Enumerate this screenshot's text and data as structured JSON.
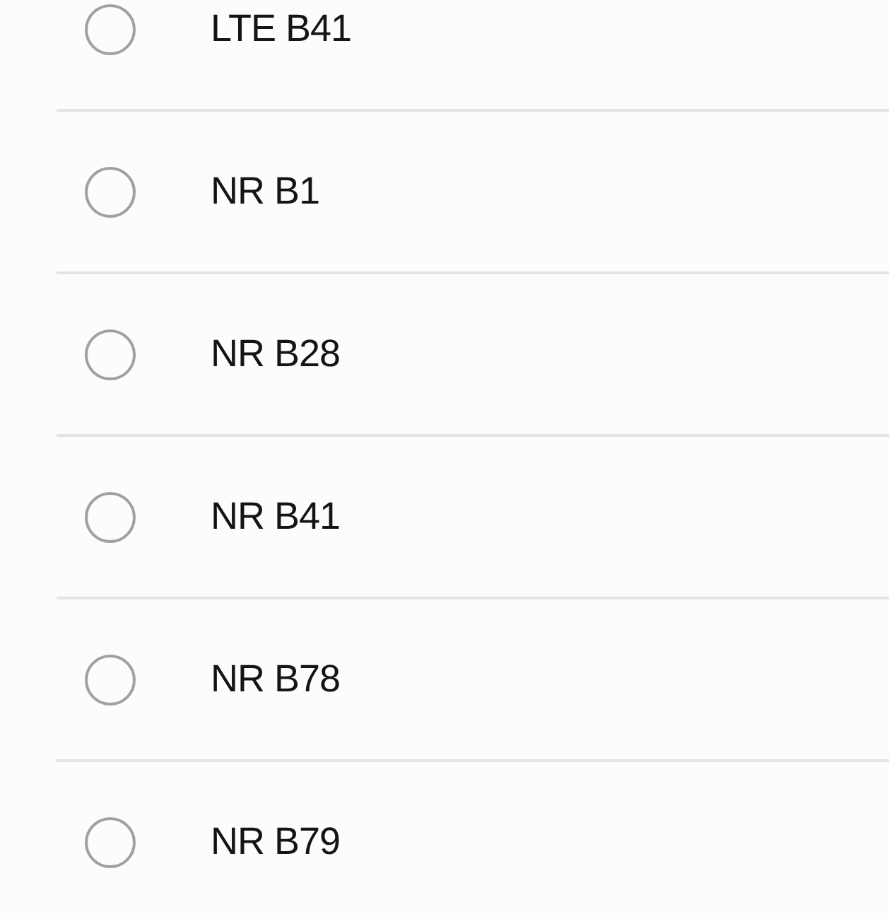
{
  "bands": [
    {
      "label": "LTE B41",
      "selected": false
    },
    {
      "label": "NR B1",
      "selected": false
    },
    {
      "label": "NR B28",
      "selected": false
    },
    {
      "label": "NR B41",
      "selected": false
    },
    {
      "label": "NR B78",
      "selected": false
    },
    {
      "label": "NR B79",
      "selected": false
    }
  ]
}
